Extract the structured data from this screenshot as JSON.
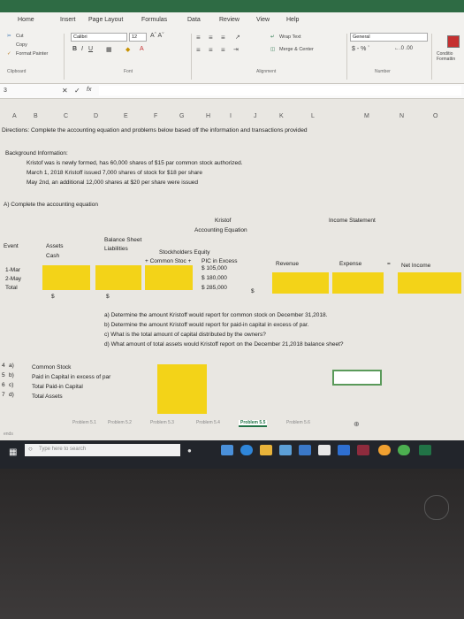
{
  "ribbon": {
    "tabs": [
      "Home",
      "Insert",
      "Page Layout",
      "Formulas",
      "Data",
      "Review",
      "View",
      "Help"
    ],
    "cut": "Cut",
    "copy": "Copy",
    "format_painter": "Format Painter",
    "font_name": "Calibri",
    "font_size": "12",
    "wrap_text": "Wrap Text",
    "merge_center": "Merge & Center",
    "number_format": "General",
    "currency": "$ - % ʼ",
    "conditional": "Conditio Formattin",
    "groups": {
      "clipboard": "Clipboard",
      "font": "Font",
      "alignment": "Alignment",
      "number": "Number"
    }
  },
  "formula_bar": {
    "name_box": "3",
    "fx": "fx"
  },
  "columns": [
    "A",
    "B",
    "C",
    "D",
    "E",
    "F",
    "G",
    "H",
    "I",
    "J",
    "K",
    "L",
    "M",
    "N",
    "O"
  ],
  "sheet": {
    "directions": "Directions: Complete the accounting equation and problems below based off the information and transactions provided",
    "background_title": "Background Information:",
    "background": [
      "Kristof was is newly formed, has 60,000 shares of $15 par common stock authorized.",
      "March 1, 2018 Kristoff issued 7,000 shares of stock for $18 per share",
      "May 2nd, an additional 12,000 shares at $20 per share were issued"
    ],
    "section_a": "A) Complete the accounting equation",
    "company": "Kristof",
    "equation_title": "Accounting Equation",
    "balance_sheet": "Balance Sheet",
    "income_statement": "Income Statement",
    "headers": {
      "event": "Event",
      "assets": "Assets",
      "cash": "Cash",
      "liabilities": "Liabilities",
      "equity": "Stockholders Equity",
      "common": "+ Common Stoc +",
      "pic": "PIC in Excess",
      "revenue": "Revenue",
      "expense": "Expense",
      "minus": "=",
      "net_income": "Net Income"
    },
    "rows": [
      {
        "event": "1-Mar",
        "pic": "$ 105,000"
      },
      {
        "event": "2-May",
        "pic": "$ 180,000"
      },
      {
        "event": "Total",
        "assets": "$",
        "liabilities": "$",
        "pic": "$ 285,000",
        "extra": "$"
      }
    ],
    "questions": [
      "a) Determine the amount Kristoff would report for common stock on December 31,2018.",
      "b) Determine the amount Kristoff would report for paid-in capital in excess of par.",
      "c) What is the total amount of capital distributed by the owners?",
      "d) What amount of total assets would Kristoff report on the December 21,2018 balance sheet?"
    ],
    "answer_letters": [
      "a)",
      "b)",
      "c)",
      "d)"
    ],
    "answer_labels": [
      "Common Stock",
      "Paid in Capital in excess of par",
      "Total Paid-in Capital",
      "Total Assets"
    ],
    "row_marks": [
      "4",
      "5",
      "6",
      "7"
    ]
  },
  "sheet_tabs": [
    "Problem 5.1",
    "Problem 5.2",
    "Problem 5.3",
    "Problem 5.4",
    "Problem 5.5",
    "Problem 5.6"
  ],
  "active_tab": "Problem 5.5",
  "status": "ends",
  "taskbar": {
    "search_placeholder": "Type here to search"
  },
  "colors": {
    "highlight": "#f3d318",
    "excel_green": "#217346"
  }
}
